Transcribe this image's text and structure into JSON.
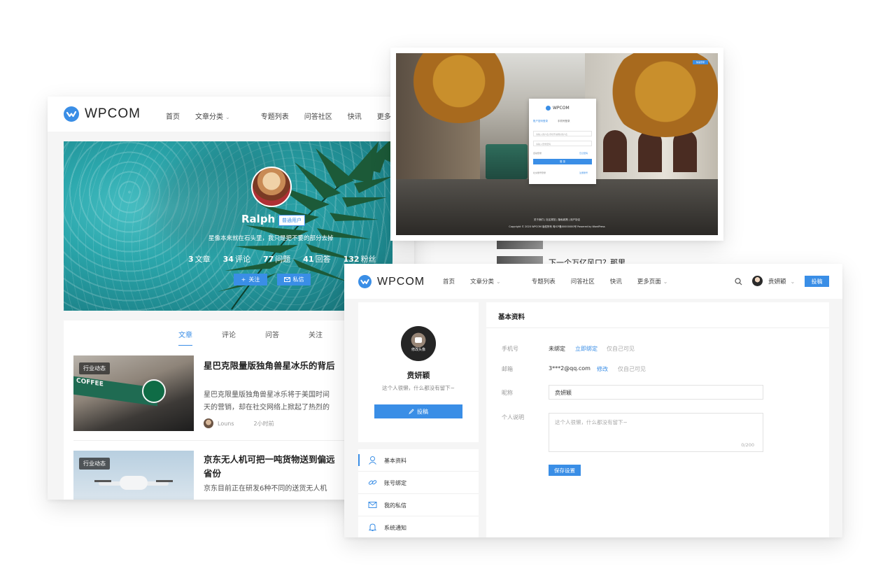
{
  "brand": {
    "name": "WPCOM",
    "color": "#3a8ee6"
  },
  "nav": {
    "items": [
      "首页",
      "文章分类",
      "专题列表",
      "问答社区",
      "快讯",
      "更多页面"
    ],
    "truncated_more": "更多页"
  },
  "profile": {
    "name": "Ralph",
    "badge": "普通用户",
    "bio": "星像本来就在石头里，我只是把不要的部分去掉",
    "stats": [
      {
        "num": "3",
        "label": "文章"
      },
      {
        "num": "34",
        "label": "评论"
      },
      {
        "num": "77",
        "label": "问题"
      },
      {
        "num": "41",
        "label": "回答"
      },
      {
        "num": "132",
        "label": "粉丝"
      }
    ],
    "follow_label": "关注",
    "message_label": "私信",
    "tabs": [
      "文章",
      "评论",
      "问答",
      "关注"
    ],
    "articles": [
      {
        "tag": "行业动态",
        "title": "星巴克限量版独角兽星冰乐的背后",
        "lines": [
          "星巴克限量版独角兽星冰乐将于美国时间",
          "天的营销，却在社交网络上掀起了热烈的"
        ],
        "author": "Louns",
        "time": "2小时前"
      },
      {
        "tag": "行业动态",
        "title": "京东无人机可把一吨货物送到偏远",
        "title2": "省份",
        "lines": [
          "京东目前正在研发6种不同的送货无人机"
        ]
      }
    ]
  },
  "peek": {
    "text": "下一个万亿风口？那里"
  },
  "login": {
    "tabs": [
      "账户密码登录",
      "手机号登录"
    ],
    "username_placeholder": "请输入用户名/手机号/邮箱/用户名",
    "password_placeholder": "请输入登录密码",
    "remember": "自动登录",
    "forgot": "忘记密码",
    "submit": "登 录",
    "social_label": "社交账号登录",
    "register": "注册账号",
    "chip": "快速登录",
    "footer_links": "关于我们 | 社区规范 | 隐私政策 | 用户协议",
    "footer_copy": "Copyright © 2020 WPCOM 版权所有 粤ICP备00000000号 Powered by WordPress"
  },
  "settings": {
    "user": {
      "name": "贲妍颖",
      "bio": "这个人很懒，什么都没有留下~",
      "avatar_caption": "修改头像"
    },
    "post_label": "投稿",
    "menu": [
      "基本资料",
      "账号绑定",
      "我的私信",
      "系统通知"
    ],
    "section_title": "基本资料",
    "fields": {
      "phone": {
        "label": "手机号",
        "value": "未绑定",
        "action": "立即绑定",
        "hint": "仅自己可见"
      },
      "email": {
        "label": "邮箱",
        "value": "3***2@qq.com",
        "action": "修改",
        "hint": "仅自己可见"
      },
      "nickname": {
        "label": "昵称",
        "value": "贲妍颖"
      },
      "description": {
        "label": "个人说明",
        "placeholder": "这个人很懒，什么都没有留下~",
        "counter": "0/200"
      }
    },
    "save_label": "保存设置"
  }
}
